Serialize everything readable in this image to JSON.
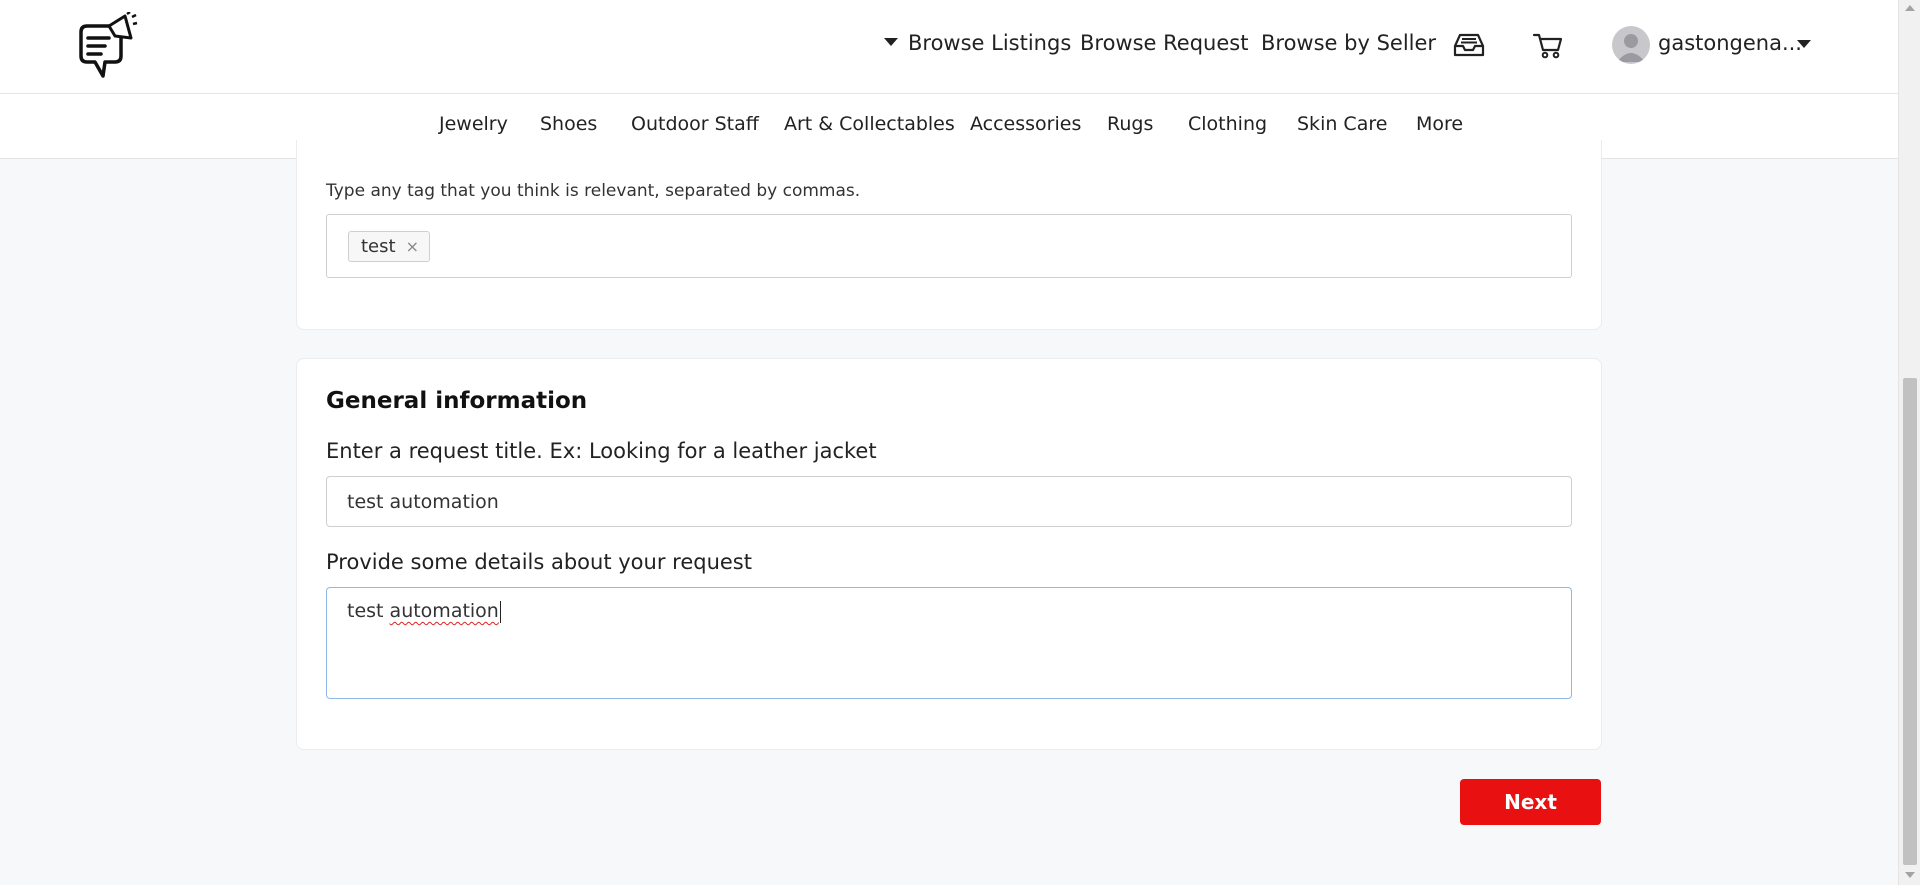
{
  "header": {
    "nav": {
      "browse_listings": "Browse Listings",
      "browse_request": "Browse Request",
      "browse_by_seller": "Browse by Seller"
    },
    "icons": [
      "inbox-icon",
      "cart-icon"
    ],
    "user": {
      "name": "gastongena..."
    }
  },
  "categories": [
    "Jewelry",
    "Shoes",
    "Outdoor Staff",
    "Art & Collectables",
    "Accessories",
    "Rugs",
    "Clothing",
    "Skin Care",
    "More"
  ],
  "tags_section": {
    "hint": "Type any tag that you think is relevant, separated by commas.",
    "tags": [
      "test"
    ],
    "remove_symbol": "×"
  },
  "general_info": {
    "title": "General information",
    "title_label": "Enter a request title. Ex: Looking for a leather jacket",
    "title_value": "test automation",
    "details_label": "Provide some details about your request",
    "details_value_word1": "test",
    "details_value_word2": "automation"
  },
  "actions": {
    "next_label": "Next"
  },
  "colors": {
    "accent": "#e81010",
    "focus_border": "#8fb8e8"
  }
}
